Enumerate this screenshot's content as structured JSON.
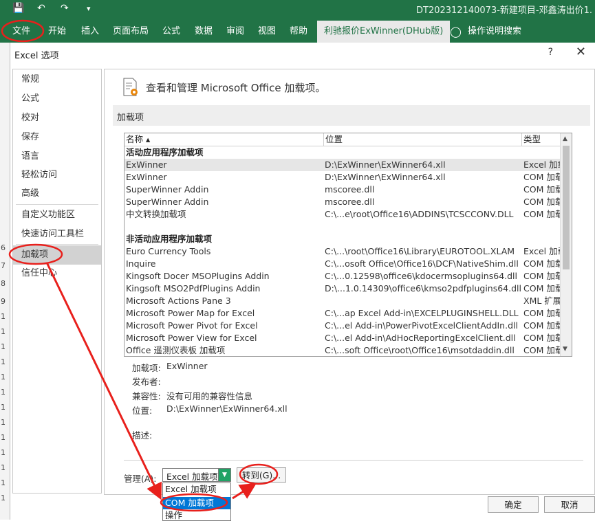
{
  "excel": {
    "doc_title": "DT202312140073-新建项目-邓鑫涛出价1.",
    "ribbon_tabs": [
      "文件",
      "开始",
      "插入",
      "页面布局",
      "公式",
      "数据",
      "审阅",
      "视图",
      "帮助"
    ],
    "special_tab": "利驰报价ExWinner(DHub版)",
    "tell_me": "操作说明搜索",
    "row_numbers": [
      "6",
      "7",
      "8",
      "9",
      "1",
      "1",
      "1",
      "1",
      "1",
      "1",
      "1",
      "1",
      "1",
      "1",
      "1",
      "1",
      "1"
    ]
  },
  "dialog": {
    "title": "Excel 选项",
    "help": "?",
    "close": "✕",
    "nav": [
      "常规",
      "公式",
      "校对",
      "保存",
      "语言",
      "轻松访问",
      "高级",
      "自定义功能区",
      "快速访问工具栏",
      "加载项",
      "信任中心"
    ],
    "header": "查看和管理 Microsoft Office 加载项。",
    "section": "加载项",
    "columns": {
      "name": "名称 ▴",
      "location": "位置",
      "type": "类型"
    },
    "active_group": "活动应用程序加载项",
    "inactive_group": "非活动应用程序加载项",
    "active_rows": [
      {
        "name": "ExWinner",
        "location": "D:\\ExWinner\\ExWinner64.xll",
        "type": "Excel 加载项"
      },
      {
        "name": "ExWinner",
        "location": "D:\\ExWinner\\ExWinner64.xll",
        "type": "COM 加载项"
      },
      {
        "name": "SuperWinner Addin",
        "location": "mscoree.dll",
        "type": "COM 加载项"
      },
      {
        "name": "SuperWinner Addin",
        "location": "mscoree.dll",
        "type": "COM 加载项"
      },
      {
        "name": "中文转换加载项",
        "location": "C:\\...e\\root\\Office16\\ADDINS\\TCSCCONV.DLL",
        "type": "COM 加载项"
      }
    ],
    "inactive_rows": [
      {
        "name": "Euro Currency Tools",
        "location": "C:\\...\\root\\Office16\\Library\\EUROTOOL.XLAM",
        "type": "Excel 加载项"
      },
      {
        "name": "Inquire",
        "location": "C:\\...osoft Office\\Office16\\DCF\\NativeShim.dll",
        "type": "COM 加载项"
      },
      {
        "name": "Kingsoft Docer MSOPlugins Addin",
        "location": "C:\\...0.12598\\office6\\kdocermsoplugins64.dll",
        "type": "COM 加载项"
      },
      {
        "name": "Kingsoft MSO2PdfPlugins Addin",
        "location": "D:\\...1.0.14309\\office6\\kmso2pdfplugins64.dll",
        "type": "COM 加载项"
      },
      {
        "name": "Microsoft Actions Pane 3",
        "location": "",
        "type": "XML 扩展包"
      },
      {
        "name": "Microsoft Power Map for Excel",
        "location": "C:\\...ap Excel Add-in\\EXCELPLUGINSHELL.DLL",
        "type": "COM 加载项"
      },
      {
        "name": "Microsoft Power Pivot for Excel",
        "location": "C:\\...el Add-in\\PowerPivotExcelClientAddIn.dll",
        "type": "COM 加载项"
      },
      {
        "name": "Microsoft Power View for Excel",
        "location": "C:\\...el Add-in\\AdHocReportingExcelClient.dll",
        "type": "COM 加载项"
      },
      {
        "name": "Office 遥测仪表板 加载项",
        "location": "C:\\...soft Office\\root\\Office16\\msotdaddin.dll",
        "type": "COM 加载项"
      }
    ],
    "details": {
      "addin_label": "加载项:",
      "addin_value": "ExWinner",
      "publisher_label": "发布者:",
      "publisher_value": "",
      "compat_label": "兼容性:",
      "compat_value": "没有可用的兼容性信息",
      "location_label": "位置:",
      "location_value": "D:\\ExWinner\\ExWinner64.xll",
      "desc_label": "描述:"
    },
    "manage_label": "管理(A):",
    "manage_value": "Excel 加载项",
    "manage_options": [
      "Excel 加载项",
      "COM 加载项",
      "操作"
    ],
    "goto": "转到(G)...",
    "ok": "确定",
    "cancel": "取消"
  },
  "colors": {
    "excel_green": "#217346",
    "annotation_red": "#e8201c",
    "highlight_blue": "#0078d7"
  }
}
